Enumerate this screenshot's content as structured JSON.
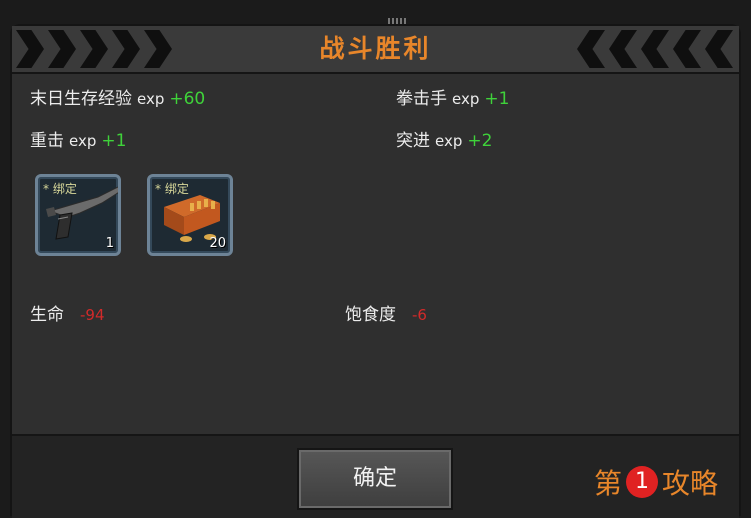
{
  "dialog": {
    "title": "战斗胜利",
    "confirm_label": "确定"
  },
  "exp_gains": [
    {
      "name": "末日生存经验",
      "unit": "exp",
      "value": "+60"
    },
    {
      "name": "拳击手",
      "unit": "exp",
      "value": "+1"
    },
    {
      "name": "重击",
      "unit": "exp",
      "value": "+1"
    },
    {
      "name": "突进",
      "unit": "exp",
      "value": "+2"
    }
  ],
  "items": [
    {
      "tag": "* 绑定",
      "count": "1",
      "icon": "pistol-icon"
    },
    {
      "tag": "* 绑定",
      "count": "20",
      "icon": "ammo-box-icon"
    }
  ],
  "stats": [
    {
      "label": "生命",
      "value": "-94"
    },
    {
      "label": "饱食度",
      "value": "-6"
    }
  ],
  "watermark": {
    "prefix": "第",
    "number": "1",
    "suffix": "攻略"
  },
  "colors": {
    "title": "#e8862a",
    "gain": "#3fd23a",
    "loss": "#d22a2a"
  }
}
